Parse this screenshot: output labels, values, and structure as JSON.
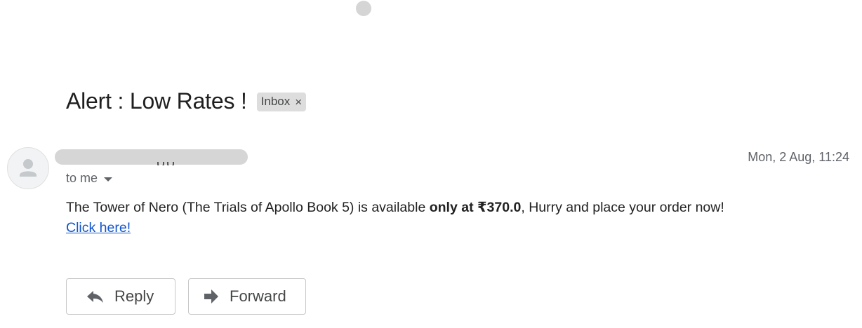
{
  "email": {
    "subject": "Alert : Low Rates !",
    "label": {
      "text": "Inbox",
      "close_glyph": "×"
    },
    "recipient": "to me",
    "date": "Mon, 2 Aug, 11:24",
    "body": {
      "text_before": "The Tower of Nero (The Trials of Apollo Book 5) is available ",
      "bold_text": "only at ₹370.0",
      "text_after": ", Hurry and place your order now!",
      "link_text": "Click here!"
    }
  },
  "actions": {
    "reply_label": "Reply",
    "forward_label": "Forward"
  },
  "icons": {
    "avatar": "person-icon",
    "recipient_caret": "chevron-down-icon",
    "reply": "reply-arrow-icon",
    "forward": "forward-arrow-icon"
  },
  "colors": {
    "link": "#1155cc",
    "chip_bg": "#dddddd",
    "muted_text": "#5f6368",
    "button_border": "#c7c7c7"
  }
}
